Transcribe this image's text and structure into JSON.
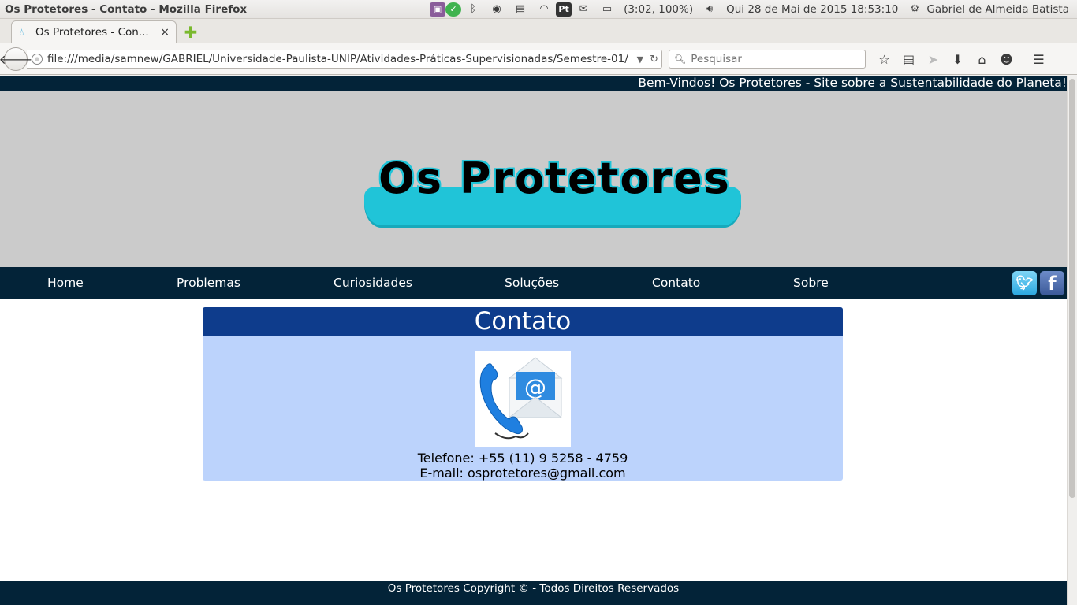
{
  "window": {
    "title": "Os Protetores - Contato - Mozilla Firefox"
  },
  "system_tray": {
    "battery": "(3:02, 100%)",
    "datetime": "Qui 28 de Mai de 2015 18:53:10",
    "user": "Gabriel de Almeida Batista",
    "pt_label": "Pt"
  },
  "tab": {
    "label": "Os Protetores - Con...",
    "close": "×"
  },
  "navbar": {
    "url": "file:///media/samnew/GABRIEL/Universidade-Paulista-UNIP/Atividades-Práticas-Supervisionadas/Semestre-01/",
    "search_placeholder": "Pesquisar"
  },
  "page": {
    "ticker": "Bem-Vindos! Os Protetores - Site sobre a Sustentabilidade do Planeta!",
    "logo_text": "Os Protetores",
    "menu": [
      "Home",
      "Problemas",
      "Curiosidades",
      "Soluções",
      "Contato",
      "Sobre"
    ],
    "panel": {
      "heading": "Contato",
      "phone": "Telefone: +55 (11) 9 5258 - 4759",
      "email": "E-mail: osprotetores@gmail.com"
    },
    "footer": "Os Protetores Copyright © - Todos Direitos Reservados"
  }
}
